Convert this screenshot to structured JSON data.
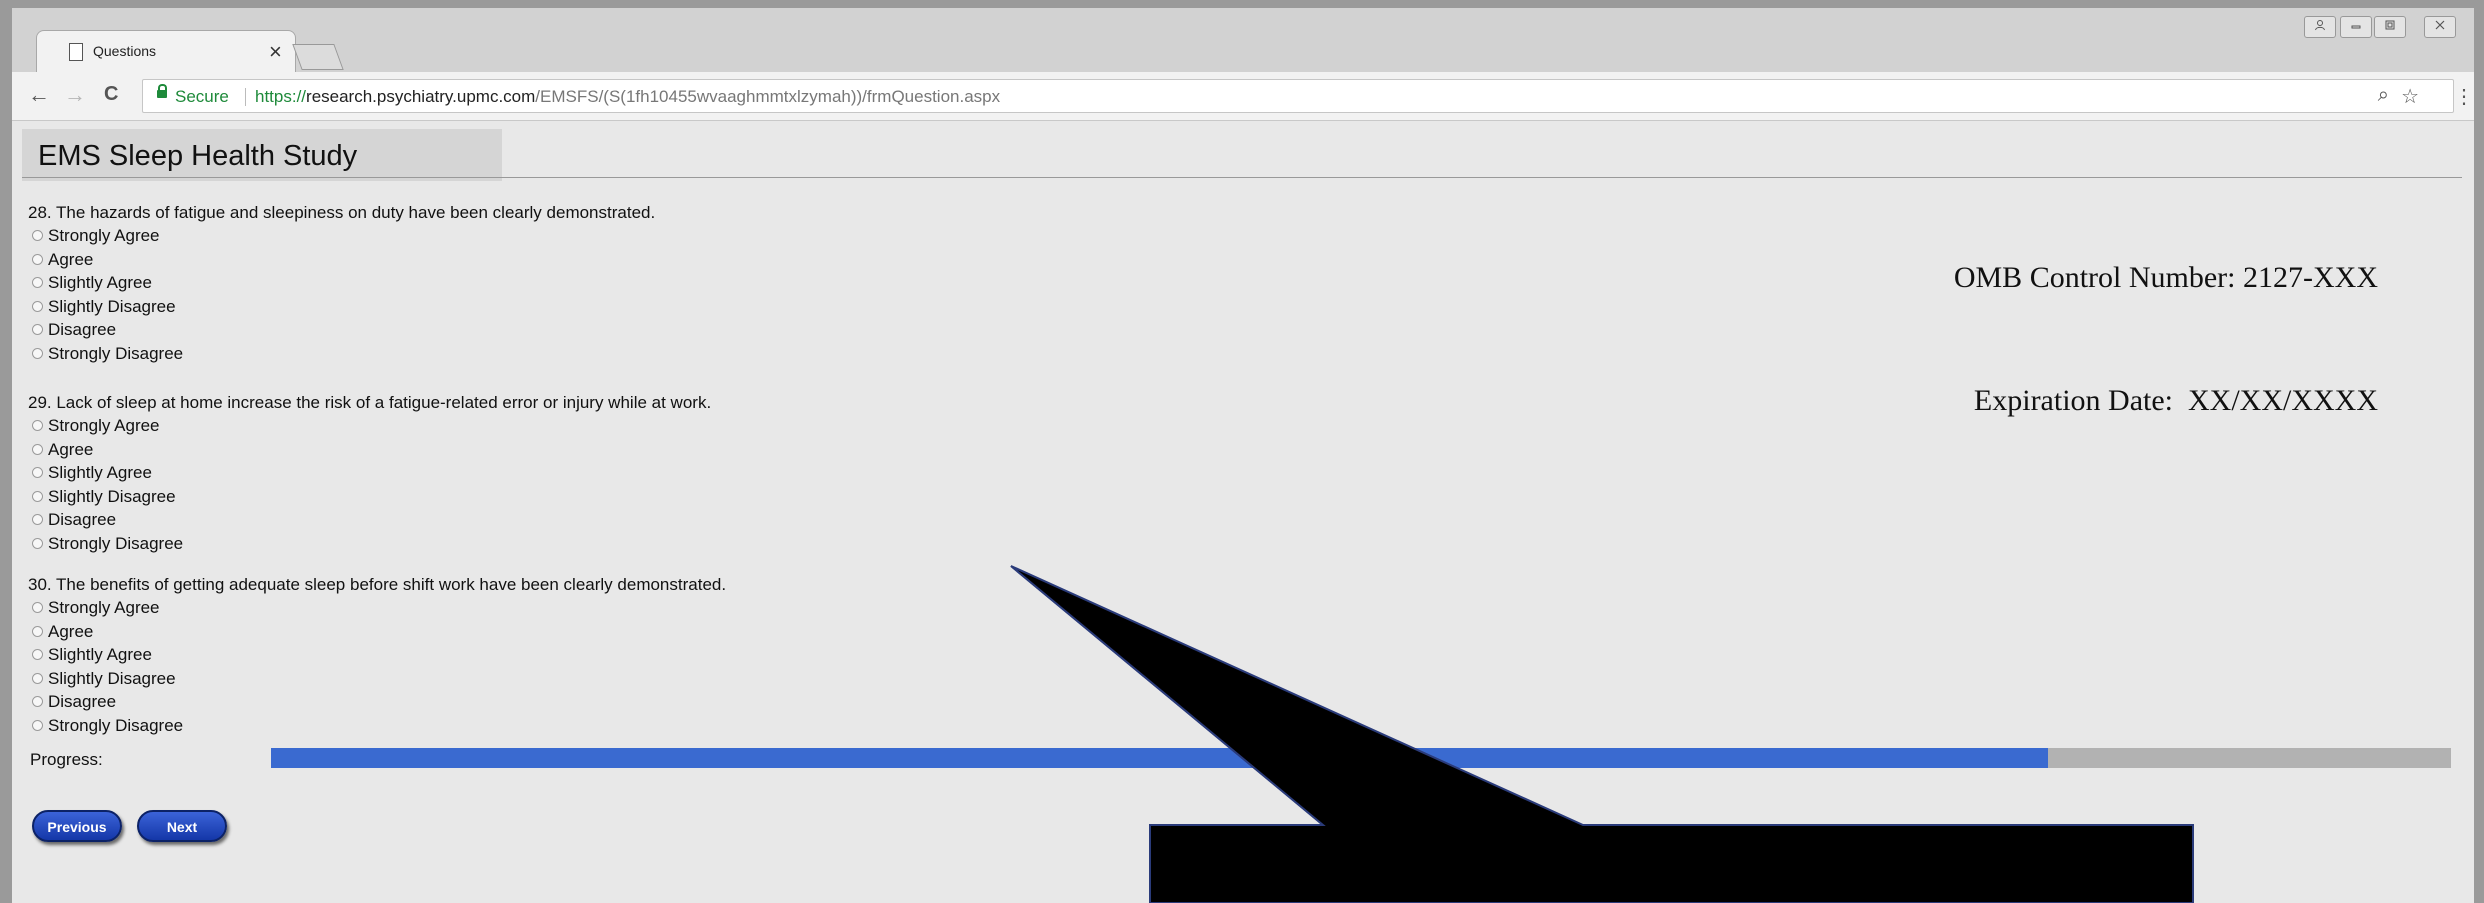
{
  "browser": {
    "tab_title": "Questions",
    "tab_close": "×",
    "secure_label": "Secure",
    "url_scheme": "https://",
    "url_host": "research.psychiatry.upmc.com",
    "url_path": "/EMSFS/(S(1fh10455wvaaghmmtxlzymah))/frmQuestion.aspx",
    "icons": {
      "back": "←",
      "forward": "→",
      "reload": "C",
      "zoom": "⌕",
      "star": "☆",
      "menu": "⋮",
      "user": "👤",
      "minimize": "—",
      "maximize": "▢",
      "close": "✕"
    }
  },
  "page": {
    "site_title": "EMS Sleep Health Study",
    "omb_line1": "OMB Control Number: 2127-XXX",
    "omb_line2": "Expiration Date:  XX/XX/XXXX",
    "questions": [
      {
        "text": "28. The hazards of fatigue and sleepiness on duty have been clearly demonstrated.",
        "options": [
          "Strongly Agree",
          "Agree",
          "Slightly Agree",
          "Slightly Disagree",
          "Disagree",
          "Strongly Disagree"
        ]
      },
      {
        "text": "29. Lack of sleep at home increase the risk of a fatigue-related error or injury while at work.",
        "options": [
          "Strongly Agree",
          "Agree",
          "Slightly Agree",
          "Slightly Disagree",
          "Disagree",
          "Strongly Disagree"
        ]
      },
      {
        "text": "30. The benefits of getting adequate sleep before shift work have been clearly demonstrated.",
        "options": [
          "Strongly Agree",
          "Agree",
          "Slightly Agree",
          "Slightly Disagree",
          "Disagree",
          "Strongly Disagree"
        ]
      }
    ],
    "progress_label": "Progress:",
    "progress_fraction": 0.815,
    "previous_label": "Previous",
    "next_label": "Next"
  },
  "colors": {
    "progress_fill": "#3a6ad0",
    "progress_track": "#b2b2b2",
    "button_blue": "#1437a8",
    "secure_green": "#1e8a3a"
  }
}
